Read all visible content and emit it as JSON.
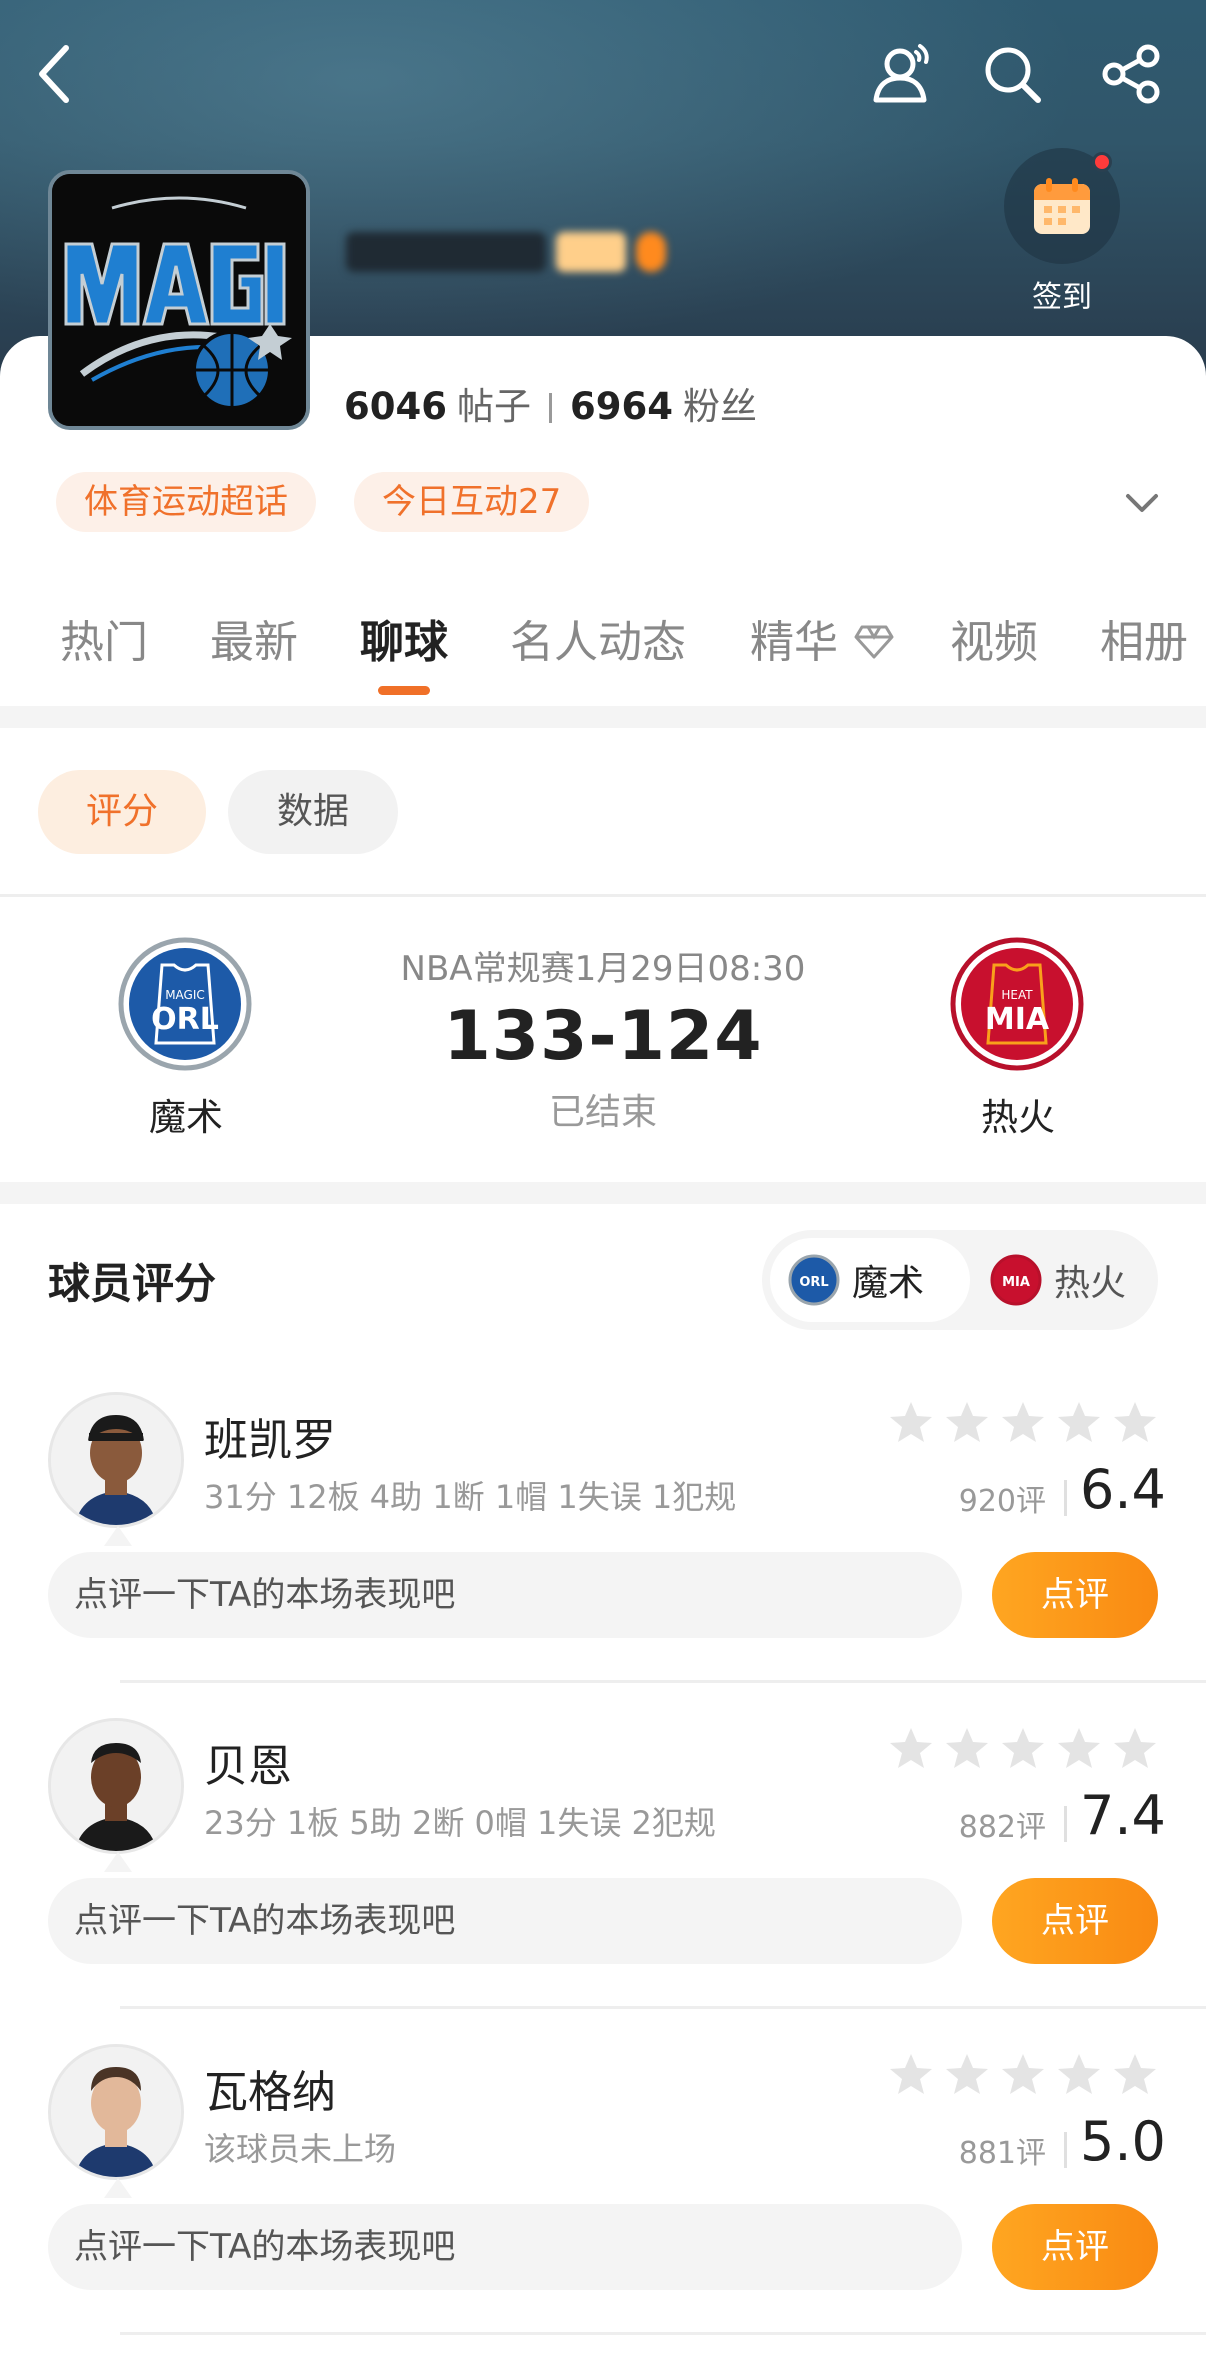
{
  "header": {
    "checkin_label": "签到"
  },
  "community": {
    "posts_count": "6046",
    "posts_unit": "帖子",
    "fans_count": "6964",
    "fans_unit": "粉丝",
    "tags": [
      "体育运动超话",
      "今日互动27"
    ]
  },
  "tabs": [
    {
      "label": "热门"
    },
    {
      "label": "最新"
    },
    {
      "label": "聊球"
    },
    {
      "label": "名人动态"
    },
    {
      "label": "精华"
    },
    {
      "label": "视频"
    },
    {
      "label": "相册"
    }
  ],
  "active_tab": "聊球",
  "filters": {
    "rating": "评分",
    "data": "数据"
  },
  "match": {
    "info": "NBA常规赛1月29日08:30",
    "score": "133-124",
    "status": "已结束",
    "home": {
      "name": "魔术",
      "logo_text": "ORL",
      "logo_sub": "MAGIC",
      "color": "#1d5aa8"
    },
    "away": {
      "name": "热火",
      "logo_text": "MIA",
      "logo_sub": "HEAT",
      "color": "#c8102e"
    }
  },
  "ratings": {
    "title": "球员评分",
    "team_selected": "魔术",
    "team_other": "热火",
    "comment_placeholder": "点评一下TA的本场表现吧",
    "comment_button": "点评",
    "players": [
      {
        "name": "班凯罗",
        "stats": "31分 12板 4助 1断 1帽 1失误 1犯规",
        "count": "920评",
        "score": "6.4"
      },
      {
        "name": "贝恩",
        "stats": "23分 1板 5助 2断 0帽 1失误 2犯规",
        "count": "882评",
        "score": "7.4"
      },
      {
        "name": "瓦格纳",
        "stats": "该球员未上场",
        "count": "881评",
        "score": "5.0"
      }
    ]
  },
  "colors": {
    "accent": "#f0712b",
    "button_orange": "#fa8e14",
    "banner": "#2f5a70"
  }
}
